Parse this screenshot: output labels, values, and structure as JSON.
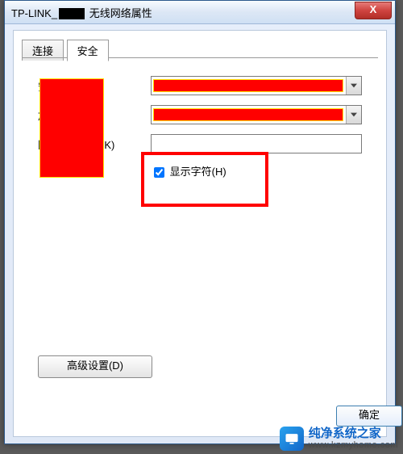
{
  "window": {
    "title_prefix": "TP-LINK_",
    "title_suffix": " 无线网络属性",
    "close_glyph": "X"
  },
  "tabs": [
    {
      "label": "连接",
      "active": false
    },
    {
      "label": "安全",
      "active": true
    }
  ],
  "form": {
    "security_type": {
      "label": "安全类型(E)：",
      "value": ""
    },
    "encryption_type": {
      "label": "加密类型(N)：",
      "value": ""
    },
    "network_key": {
      "label": "网络安全密钥(K)",
      "value": ""
    },
    "show_chars": {
      "label": "显示字符(H)",
      "checked": true
    }
  },
  "advanced_button": "高级设置(D)",
  "ok_button": "确定",
  "watermark": {
    "name": "纯净系统之家",
    "url": "www.kzmyhome.com"
  }
}
